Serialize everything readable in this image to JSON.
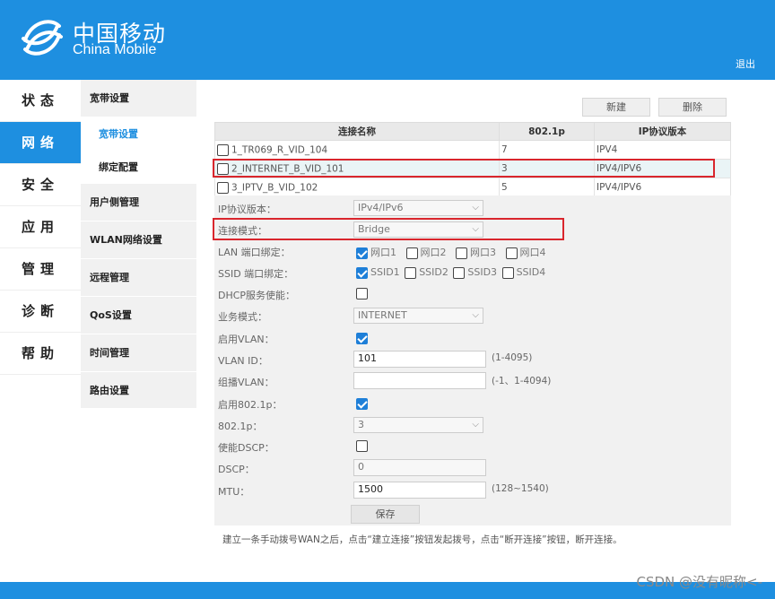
{
  "brand": {
    "cn": "中国移动",
    "en": "China Mobile",
    "logout": "退出",
    "color": "#1e8fe0"
  },
  "main_nav": [
    "状态",
    "网络",
    "安全",
    "应用",
    "管理",
    "诊断",
    "帮助"
  ],
  "sub_nav": [
    "宽带设置",
    "宽带设置",
    "绑定配置",
    "用户侧管理",
    "WLAN网络设置",
    "远程管理",
    "QoS设置",
    "时间管理",
    "路由设置"
  ],
  "buttons": {
    "new": "新建",
    "delete": "删除",
    "save": "保存"
  },
  "table": {
    "headers": [
      "连接名称",
      "802.1p",
      "IP协议版本"
    ],
    "rows": [
      {
        "name": "1_TR069_R_VID_104",
        "p": "7",
        "ip": "IPV4"
      },
      {
        "name": "2_INTERNET_B_VID_101",
        "p": "3",
        "ip": "IPV4/IPV6"
      },
      {
        "name": "3_IPTV_B_VID_102",
        "p": "5",
        "ip": "IPV4/IPV6"
      }
    ]
  },
  "form": {
    "ip_version": {
      "label": "IP协议版本：",
      "value": "IPv4/IPv6"
    },
    "conn_mode": {
      "label": "连接模式：",
      "value": "Bridge"
    },
    "lan_bind": {
      "label": "LAN 端口绑定：",
      "options": [
        "网口1",
        "网口2",
        "网口3",
        "网口4"
      ],
      "checked": [
        true,
        false,
        false,
        false
      ]
    },
    "ssid_bind": {
      "label": "SSID 端口绑定：",
      "options": [
        "SSID1",
        "SSID2",
        "SSID3",
        "SSID4"
      ],
      "checked": [
        true,
        false,
        false,
        false
      ]
    },
    "dhcp": {
      "label": "DHCP服务使能："
    },
    "service_mode": {
      "label": "业务模式：",
      "value": "INTERNET"
    },
    "vlan_enable": {
      "label": "启用VLAN："
    },
    "vlan_id": {
      "label": "VLAN ID：",
      "value": "101",
      "hint": "(1-4095)"
    },
    "mcast_vlan": {
      "label": "组播VLAN：",
      "value": "",
      "hint": "(-1、1-4094)"
    },
    "p8021_enable": {
      "label": "启用802.1p："
    },
    "p8021": {
      "label": "802.1p：",
      "value": "3"
    },
    "dscp_enable": {
      "label": "使能DSCP："
    },
    "dscp": {
      "label": "DSCP：",
      "value": "0"
    },
    "mtu": {
      "label": "MTU：",
      "value": "1500",
      "hint": "(128~1540)"
    }
  },
  "note": "建立一条手动拨号WAN之后，点击“建立连接”按钮发起拨号，点击“断开连接”按钮，断开连接。",
  "watermark": "CSDN @没有昵称<-"
}
